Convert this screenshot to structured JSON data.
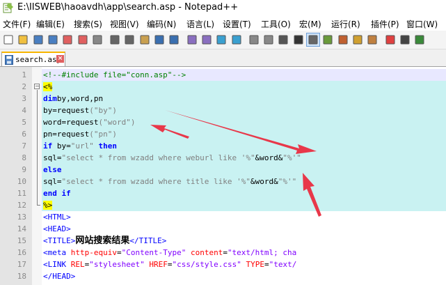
{
  "window": {
    "title": "E:\\IISWEB\\haoavdh\\app\\search.asp - Notepad++"
  },
  "menu": [
    {
      "id": "file",
      "label": "文件(F)"
    },
    {
      "id": "edit",
      "label": "编辑(E)"
    },
    {
      "id": "search",
      "label": "搜索(S)"
    },
    {
      "id": "view",
      "label": "视图(V)"
    },
    {
      "id": "encoding",
      "label": "编码(N)"
    },
    {
      "id": "language",
      "label": "语言(L)"
    },
    {
      "id": "settings",
      "label": "设置(T)"
    },
    {
      "id": "tools",
      "label": "工具(O)"
    },
    {
      "id": "macro",
      "label": "宏(M)"
    },
    {
      "id": "run",
      "label": "运行(R)"
    },
    {
      "id": "plugins",
      "label": "插件(P)"
    },
    {
      "id": "window",
      "label": "窗口(W)"
    }
  ],
  "toolbar": {
    "icons": [
      "new-file-icon",
      "open-file-icon",
      "save-icon",
      "save-all-icon",
      "close-icon",
      "close-all-icon",
      "print-icon",
      "cut-icon",
      "copy-icon",
      "paste-icon",
      "undo-icon",
      "redo-icon",
      "find-icon",
      "replace-icon",
      "zoom-in-icon",
      "zoom-out-icon",
      "sync-v-icon",
      "sync-h-icon",
      "word-wrap-icon",
      "show-all-chars-icon",
      "indent-guide-icon",
      "doc-map-icon",
      "function-list-icon",
      "folder-workspace-icon",
      "monitoring-icon",
      "record-macro-icon",
      "stop-record-icon",
      "play-macro-icon"
    ]
  },
  "tab": {
    "label": "search.asp",
    "close": "×"
  },
  "lines": [
    {
      "n": "1",
      "tokens": [
        [
          "k-comment",
          "<!--#include file=\"conn.asp\"-->"
        ]
      ]
    },
    {
      "n": "2",
      "tokens": [
        [
          "k-asp",
          "<%"
        ]
      ]
    },
    {
      "n": "3",
      "tokens": [
        [
          "k-key",
          "dim"
        ],
        [
          "",
          "by,word,pn"
        ]
      ]
    },
    {
      "n": "4",
      "tokens": [
        [
          "",
          "by=request"
        ],
        [
          "k-str",
          "(\"by\")"
        ]
      ]
    },
    {
      "n": "5",
      "tokens": [
        [
          "",
          "word=request"
        ],
        [
          "k-str",
          "(\"word\")"
        ]
      ]
    },
    {
      "n": "6",
      "tokens": [
        [
          "",
          "pn=request"
        ],
        [
          "k-str",
          "(\"pn\")"
        ]
      ]
    },
    {
      "n": "7",
      "tokens": [
        [
          "k-key",
          "if"
        ],
        [
          "",
          " by="
        ],
        [
          "k-str",
          "\"url\""
        ],
        [
          "k-key",
          " then"
        ]
      ]
    },
    {
      "n": "8",
      "tokens": [
        [
          "",
          "sql="
        ],
        [
          "k-str",
          "\"select * from wzadd where weburl like '%\""
        ],
        [
          "",
          "&word&"
        ],
        [
          "k-str",
          "\"%'\""
        ]
      ]
    },
    {
      "n": "9",
      "tokens": [
        [
          "k-key",
          "else"
        ]
      ]
    },
    {
      "n": "10",
      "tokens": [
        [
          "",
          "sql="
        ],
        [
          "k-str",
          "\"select * from wzadd where title like '%\""
        ],
        [
          "",
          "&word&"
        ],
        [
          "k-str",
          "\"%'\""
        ]
      ]
    },
    {
      "n": "11",
      "tokens": [
        [
          "k-key",
          "end if"
        ]
      ]
    },
    {
      "n": "12",
      "tokens": [
        [
          "k-asp",
          "%>"
        ]
      ]
    },
    {
      "n": "13",
      "tokens": [
        [
          "k-tag",
          "<HTML>"
        ]
      ]
    },
    {
      "n": "14",
      "tokens": [
        [
          "k-tag",
          "<HEAD>"
        ]
      ]
    },
    {
      "n": "15",
      "tokens": [
        [
          "k-tag",
          "<TITLE>"
        ],
        [
          "k-bold",
          "网站搜索结果"
        ],
        [
          "k-tag",
          "</TITLE>"
        ]
      ]
    },
    {
      "n": "16",
      "tokens": [
        [
          "k-tag",
          "<meta "
        ],
        [
          "k-attr",
          "http-equiv"
        ],
        [
          "",
          "="
        ],
        [
          "k-val",
          "\"Content-Type\""
        ],
        [
          "k-attr",
          " content"
        ],
        [
          "",
          "="
        ],
        [
          "k-val",
          "\"text/html; cha"
        ]
      ]
    },
    {
      "n": "17",
      "tokens": [
        [
          "k-tag",
          "<LINK "
        ],
        [
          "k-attr",
          "REL"
        ],
        [
          "",
          "="
        ],
        [
          "k-val",
          "\"stylesheet\""
        ],
        [
          "k-attr",
          " HREF"
        ],
        [
          "",
          "="
        ],
        [
          "k-val",
          "\"css/style.css\""
        ],
        [
          "k-attr",
          " TYPE"
        ],
        [
          "",
          "="
        ],
        [
          "k-val",
          "\"text/"
        ]
      ]
    },
    {
      "n": "18",
      "tokens": [
        [
          "k-tag",
          "</HEAD>"
        ]
      ]
    }
  ]
}
